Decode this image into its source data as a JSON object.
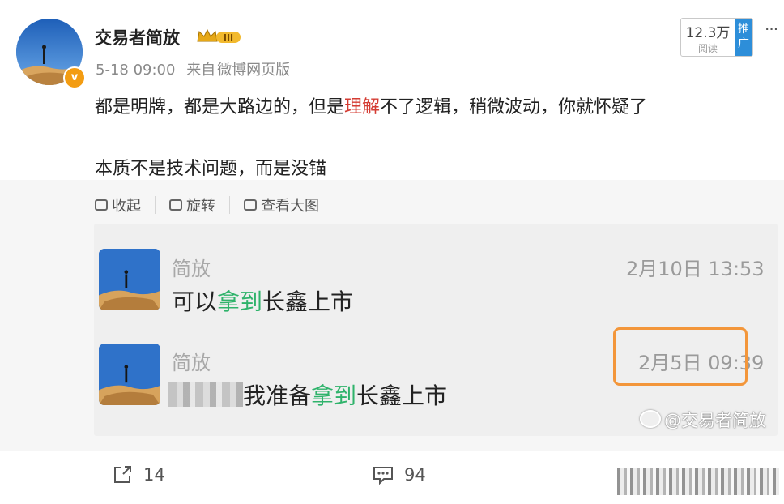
{
  "post": {
    "username": "交易者简放",
    "level_badge": "III",
    "verified_glyph": "v",
    "timestamp": "5-18 09:00",
    "source_prefix": "来自",
    "source": "微博网页版",
    "views_count": "12.3万",
    "views_label": "阅读",
    "promote_label": "推广",
    "more_glyph": "···",
    "text_line1_before": "都是明牌，都是大路边的，但是",
    "text_line1_highlight": "理解",
    "text_line1_after": "不了逻辑，稍微波动，你就怀疑了",
    "text_line2": "本质不是技术问题，而是没锚"
  },
  "image_toolbar": {
    "collapse_label": "收起",
    "rotate_label": "旋转",
    "view_large_label": "查看大图"
  },
  "chat": {
    "messages": [
      {
        "sender": "简放",
        "time": "2月10日 13:53",
        "text_before": "可以",
        "text_highlight": "拿到",
        "text_after": "长鑫上市"
      },
      {
        "sender": "简放",
        "time": "2月5日 09:39",
        "text_before": "我准备",
        "text_highlight": "拿到",
        "text_after": "长鑫上市"
      }
    ],
    "watermark": "@交易者简放"
  },
  "footer": {
    "share_count": "14",
    "comment_count": "94"
  },
  "colors": {
    "highlight_red": "#d43c33",
    "highlight_green": "#2fb36b",
    "annotation_orange": "#f3963a",
    "promo_blue": "#2d8ed9"
  }
}
